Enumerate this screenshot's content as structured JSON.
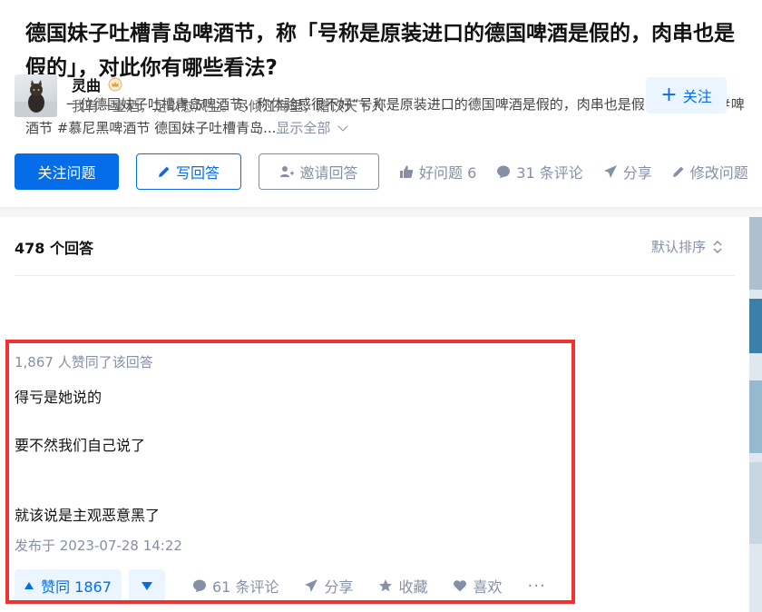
{
  "question": {
    "title": "德国妹子吐槽青岛啤酒节，称「号称是原装进口的德国啤酒是假的，肉串也是假的」，对此你有哪些看法?",
    "description": "近日，一位德国妹子吐槽青岛啤酒节，称体验感很不好“号称是原装进口的德国啤酒是假的，肉串也是假的。” #青岛 #啤酒节 #慕尼黑啤酒节 德国妹子吐槽青岛...",
    "show_all": "显示全部",
    "follow_label": "关注问题",
    "write_label": "写回答",
    "invite_label": "邀请回答",
    "good_question": "好问题 6",
    "comments": "31 条评论",
    "share": "分享",
    "edit": "修改问题"
  },
  "answers": {
    "count_label": "478 个回答",
    "sort_label": "默认排序"
  },
  "author": {
    "name": "灵曲",
    "bio": "我有一壶酒，足以慰风尘。尽倾江海里，赠饮天下人",
    "follow_label": "关注"
  },
  "answer": {
    "voters": "1,867 人赞同了该回答",
    "line1": "得亏是她说的",
    "line2": "要不然我们自己说了",
    "line3": "就该说是主观恶意黑了",
    "published": "发布于 2023-07-28 14:22",
    "upvote_label": "赞同 1867",
    "comments": "61 条评论",
    "share": "分享",
    "collect": "收藏",
    "like": "喜欢",
    "more": "···"
  },
  "colors": {
    "brand": "#056de8",
    "muted": "#8590a6",
    "highlight": "#ee3333"
  }
}
